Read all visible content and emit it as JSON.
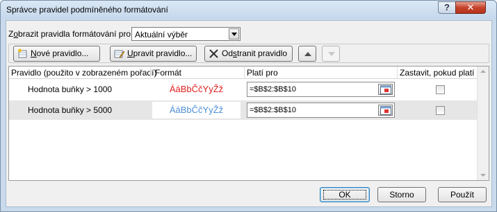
{
  "window": {
    "title": "Správce pravidel podmíněného formátování",
    "help_glyph": "?",
    "close_glyph": "✕"
  },
  "show_rules": {
    "label_prefix": "Z",
    "label_accel": "o",
    "label_rest": "brazit pravidla formátování pro:",
    "selected": "Aktuální výběr"
  },
  "toolbar": {
    "new_label_accel": "N",
    "new_label_rest": "ové pravidlo...",
    "edit_label_accel": "U",
    "edit_label_rest": "pravit pravidlo...",
    "delete_label_pre": "Od",
    "delete_label_accel": "s",
    "delete_label_rest": "tranit pravidlo"
  },
  "grid": {
    "columns": [
      "Pravidlo (použito v zobrazeném pořadí)",
      "Formát",
      "Platí pro",
      "Zastavit, pokud platí"
    ],
    "rows": [
      {
        "rule": "Hodnota buňky > 1000",
        "preview": "ÁáBbČčYyŽž",
        "preview_color": "#e02020",
        "applies_to": "=$B$2:$B$10",
        "stop_if_true": false
      },
      {
        "rule": "Hodnota buňky > 5000",
        "preview": "ÁáBbČčYyŽž",
        "preview_color": "#4f8fd6",
        "applies_to": "=$B$2:$B$10",
        "stop_if_true": false
      }
    ]
  },
  "buttons": {
    "ok": "OK",
    "cancel": "Storno",
    "apply": "Použít"
  }
}
